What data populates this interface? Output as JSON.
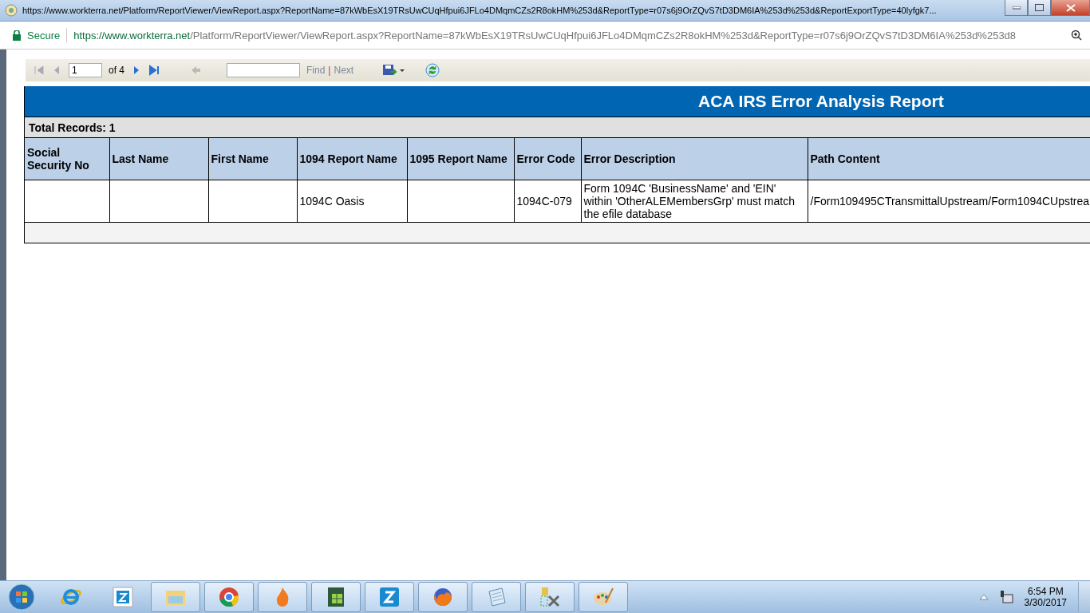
{
  "window": {
    "title": "https://www.workterra.net/Platform/ReportViewer/ViewReport.aspx?ReportName=87kWbEsX19TRsUwCUqHfpui6JFLo4DMqmCZs2R8okHM%253d&ReportType=r07s6j9OrZQvS7tD3DM6IA%253d%253d&ReportExportType=40lyfgk7..."
  },
  "address_bar": {
    "secure_label": "Secure",
    "url_host": "https://www.workterra.net",
    "url_path": "/Platform/ReportViewer/ViewReport.aspx?ReportName=87kWbEsX19TRsUwCUqHfpui6JFLo4DMqmCZs2R8okHM%253d&ReportType=r07s6j9OrZQvS7tD3DM6IA%253d%253d8"
  },
  "toolbar": {
    "page": "1",
    "page_count": "of 4",
    "find_label": "Find",
    "separator": "|",
    "next_label": "Next"
  },
  "report": {
    "title": "ACA IRS Error Analysis Report",
    "total": "Total Records: 1",
    "columns": [
      "Social Security No",
      "Last Name",
      "First Name",
      "1094 Report Name",
      "1095 Report Name",
      "Error Code",
      "Error Description",
      "Path Content"
    ],
    "rows": [
      [
        "",
        "",
        "",
        "1094C Oasis",
        "",
        "1094C-079",
        "Form 1094C 'BusinessName' and 'EIN' within 'OtherALEMembersGrp' must match the efile database",
        "/Form109495CTransmittalUpstream/Form1094CUpstrea"
      ]
    ]
  },
  "clock": {
    "time": "6:54 PM",
    "date": "3/30/2017"
  }
}
